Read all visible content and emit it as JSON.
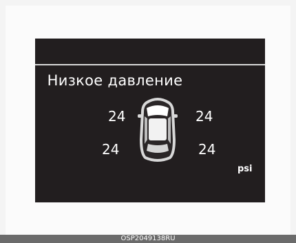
{
  "display": {
    "title": "Низкое давление",
    "unit": "psi",
    "tires": {
      "front_left": "24",
      "front_right": "24",
      "rear_left": "24",
      "rear_right": "24"
    }
  },
  "footer": {
    "code": "OSP2049138RU"
  },
  "colors": {
    "screen_bg": "#221e1f",
    "text": "#ffffff",
    "divider": "#d9d9d9"
  }
}
